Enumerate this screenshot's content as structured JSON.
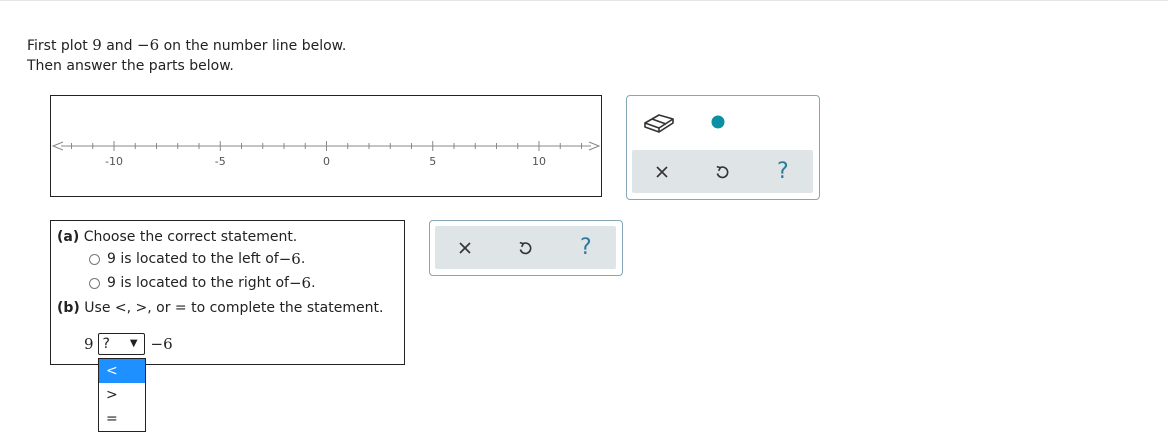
{
  "instructions": {
    "line1_prefix": "First plot ",
    "line1_num1": "9",
    "line1_and": " and ",
    "line1_num2": "−6",
    "line1_suffix": " on the number line below.",
    "line2": "Then answer the parts below."
  },
  "number_line": {
    "min": -12,
    "max": 13,
    "major_ticks": [
      -10,
      -5,
      0,
      5,
      10
    ],
    "tick_labels": [
      "-10",
      "-5",
      "0",
      "5",
      "10"
    ]
  },
  "graph_tools": {
    "eraser_icon": "eraser-icon",
    "point_tool_color": "#0a8fa3",
    "clear_icon": "close-icon",
    "undo_icon": "undo-icon",
    "help_label": "?"
  },
  "question": {
    "part_a_label": "(a)",
    "part_a_text": " Choose the correct statement.",
    "option1_prefix": "9 is located to the left of ",
    "option1_value": "−6",
    "option1_suffix": ".",
    "option2_prefix": "9 is located to the right of ",
    "option2_value": "−6",
    "option2_suffix": ".",
    "part_b_label": "(b)",
    "part_b_text": " Use <, >, or = to complete the statement.",
    "left_value": "9",
    "select_value": "?",
    "right_value": "−6",
    "select_options": [
      "<",
      ">",
      "="
    ]
  },
  "answer_tools": {
    "help_label": "?"
  },
  "colors": {
    "accent": "#2b7a9c",
    "panel_border": "#86a7b8",
    "strip_bg": "#dfe4e7",
    "dropdown_highlight": "#1e90ff"
  }
}
